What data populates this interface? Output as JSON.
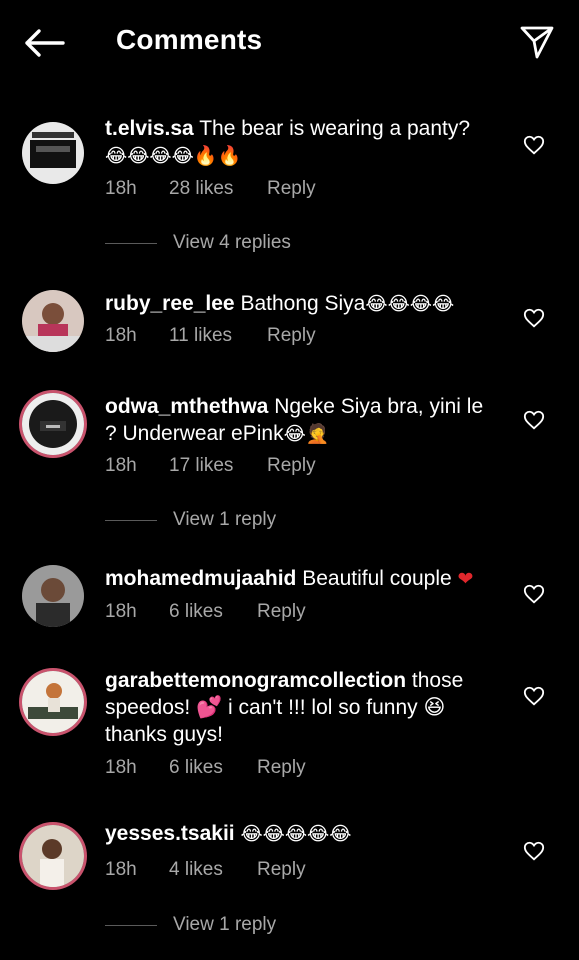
{
  "header": {
    "title": "Comments",
    "back_icon": "arrow-left-icon",
    "send_icon": "paper-plane-icon"
  },
  "colors": {
    "background": "#000000",
    "meta": "#a8a8a8",
    "story_ring": "#c9536d",
    "red_heart": "#e0272c"
  },
  "comments": [
    {
      "username": "t.elvis.sa",
      "text": "The bear is wearing a panty?",
      "emoji": "😂😂😂😂🔥🔥",
      "time": "18h",
      "likes": "28 likes",
      "reply": "Reply",
      "view_replies": "View 4 replies"
    },
    {
      "username": "ruby_ree_lee",
      "text": "Bathong Siya",
      "emoji": "😂😂😂😂",
      "time": "18h",
      "likes": "11 likes",
      "reply": "Reply"
    },
    {
      "username": "odwa_mthethwa",
      "text": "Ngeke Siya bra, yini le ? Underwear ePink",
      "emoji": "😂🤦",
      "time": "18h",
      "likes": "17 likes",
      "reply": "Reply",
      "view_replies": "View 1 reply"
    },
    {
      "username": "mohamedmujaahid",
      "text": "Beautiful couple",
      "emoji": "❤",
      "time": "18h",
      "likes": "6 likes",
      "reply": "Reply"
    },
    {
      "username": "garabettemonogramcollection",
      "text": "those speedos! 💕 i can't !!! lol so funny 😆 thanks guys!",
      "time": "18h",
      "likes": "6 likes",
      "reply": "Reply"
    },
    {
      "username": "yesses.tsakii",
      "emoji": "😂😂😂😂😂",
      "time": "18h",
      "likes": "4 likes",
      "reply": "Reply",
      "view_replies": "View 1 reply"
    }
  ]
}
